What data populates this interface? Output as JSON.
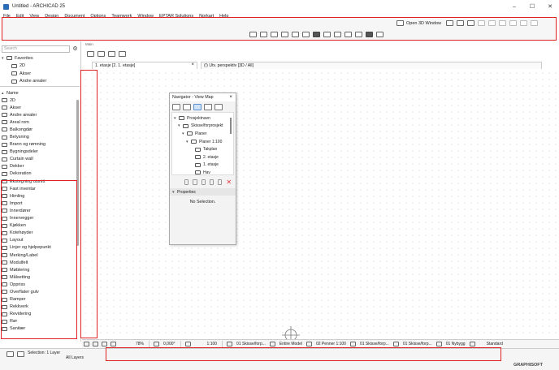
{
  "window": {
    "title": "Untitled - ARCHICAD 25",
    "controls": [
      "–",
      "☐",
      "✕"
    ]
  },
  "menu": [
    "File",
    "Edit",
    "View",
    "Design",
    "Document",
    "Options",
    "Teamwork",
    "Window",
    "EPTAR Solutions",
    "Norkart",
    "Help"
  ],
  "toolbar": {
    "open_3d_label": "Open 3D Window"
  },
  "left_panel": {
    "search_placeholder": "Search",
    "favorites_label": "Favorites",
    "favorites": [
      "2D",
      "Akser",
      "Andre arealer"
    ],
    "name_header": "Name",
    "attributes": [
      "2D",
      "Akser",
      "Andre arealer",
      "Areal rom",
      "Balkongdør",
      "Belysning",
      "Brann og rømning",
      "Bygningsdeler",
      "Curtain wall",
      "Dekker",
      "Dekoration",
      "Ekstegning utsnitt",
      "Fast inventar",
      "Himling",
      "Import",
      "Innerdører",
      "Innervegger",
      "Kjøkken",
      "Kotehøyder",
      "Layout",
      "Linjer og hjelpepunkt",
      "Merking/Label",
      "Modulfelt",
      "Møblering",
      "Målsetting",
      "Oppriss",
      "Overflater gulv",
      "Ramper",
      "Rekkverk",
      "Revidering",
      "Rør",
      "Sanitær"
    ]
  },
  "view_tabs": {
    "view_label": "Main",
    "tabs": [
      {
        "label": "1. etasje [2. 1. etasje]",
        "active": true
      },
      {
        "label": "(!) Utv. perspektiv [3D / All]",
        "active": false
      }
    ]
  },
  "navigator": {
    "title": "Navigator - View Map",
    "tree": [
      {
        "label": "Prosjektnavn",
        "level": 0
      },
      {
        "label": "Skisse/forprosjekt",
        "level": 1
      },
      {
        "label": "Planer",
        "level": 2
      },
      {
        "label": "Planer 1:100",
        "level": 3
      },
      {
        "label": "Takplan",
        "level": 4
      },
      {
        "label": "2. etasje",
        "level": 4
      },
      {
        "label": "1. etasje",
        "level": 4
      },
      {
        "label": "Hav",
        "level": 4
      }
    ],
    "properties_label": "Properties",
    "no_selection": "No Selection."
  },
  "statusbar": {
    "zoom": "78%",
    "angle": "0,000°",
    "scale": "1:100",
    "layer_combo": "01 Skisse/forp...",
    "model_view": "Entire Model",
    "pen_set": "02 Penner 1:100",
    "mvo": "01 Skisse/forp...",
    "dimension": "01 Skisse/forp...",
    "renovation": "01 Nybygg",
    "structure": "Standard"
  },
  "bottom": {
    "selection_line1": "Selection: 1 Layer",
    "selection_line2": "All Layers",
    "brand": "GRAPHISOFT"
  },
  "colors": {
    "highlight_red": "#dd2222",
    "accent_blue": "#2a6db5"
  }
}
